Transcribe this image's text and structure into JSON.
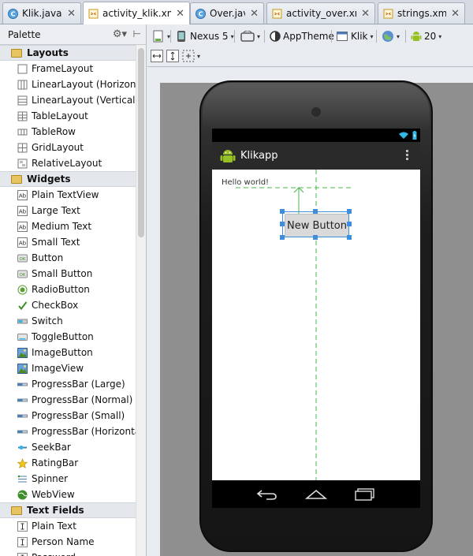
{
  "tabs": [
    {
      "label": "Klik.java",
      "type": "java",
      "active": false
    },
    {
      "label": "activity_klik.xml",
      "type": "xml",
      "active": true
    },
    {
      "label": "Over.java",
      "type": "java",
      "active": false
    },
    {
      "label": "activity_over.xml",
      "type": "xml",
      "active": false
    },
    {
      "label": "strings.xml",
      "type": "xml",
      "active": false
    }
  ],
  "palette": {
    "title": "Palette",
    "categories": [
      {
        "name": "Layouts",
        "items": [
          {
            "label": "FrameLayout",
            "icon": "frame-layout-icon"
          },
          {
            "label": "LinearLayout (Horizontal)",
            "icon": "linear-horizontal-icon"
          },
          {
            "label": "LinearLayout (Vertical)",
            "icon": "linear-vertical-icon"
          },
          {
            "label": "TableLayout",
            "icon": "table-layout-icon"
          },
          {
            "label": "TableRow",
            "icon": "table-row-icon"
          },
          {
            "label": "GridLayout",
            "icon": "grid-layout-icon"
          },
          {
            "label": "RelativeLayout",
            "icon": "relative-layout-icon"
          }
        ]
      },
      {
        "name": "Widgets",
        "items": [
          {
            "label": "Plain TextView",
            "icon": "textview-icon"
          },
          {
            "label": "Large Text",
            "icon": "large-text-icon"
          },
          {
            "label": "Medium Text",
            "icon": "medium-text-icon"
          },
          {
            "label": "Small Text",
            "icon": "small-text-icon"
          },
          {
            "label": "Button",
            "icon": "button-icon"
          },
          {
            "label": "Small Button",
            "icon": "small-button-icon"
          },
          {
            "label": "RadioButton",
            "icon": "radio-button-icon"
          },
          {
            "label": "CheckBox",
            "icon": "checkbox-icon"
          },
          {
            "label": "Switch",
            "icon": "switch-icon"
          },
          {
            "label": "ToggleButton",
            "icon": "toggle-button-icon"
          },
          {
            "label": "ImageButton",
            "icon": "image-button-icon"
          },
          {
            "label": "ImageView",
            "icon": "image-view-icon"
          },
          {
            "label": "ProgressBar (Large)",
            "icon": "progressbar-icon"
          },
          {
            "label": "ProgressBar (Normal)",
            "icon": "progressbar-icon"
          },
          {
            "label": "ProgressBar (Small)",
            "icon": "progressbar-icon"
          },
          {
            "label": "ProgressBar (Horizontal)",
            "icon": "progressbar-icon"
          },
          {
            "label": "SeekBar",
            "icon": "seekbar-icon"
          },
          {
            "label": "RatingBar",
            "icon": "rating-bar-icon"
          },
          {
            "label": "Spinner",
            "icon": "spinner-icon"
          },
          {
            "label": "WebView",
            "icon": "webview-icon"
          }
        ]
      },
      {
        "name": "Text Fields",
        "items": [
          {
            "label": "Plain Text",
            "icon": "text-field-icon"
          },
          {
            "label": "Person Name",
            "icon": "text-field-icon"
          },
          {
            "label": "Password",
            "icon": "text-field-icon"
          }
        ]
      }
    ]
  },
  "toolbar": {
    "device": "Nexus 5",
    "theme": "AppTheme",
    "activity": "Klik",
    "api_level": "20"
  },
  "preview": {
    "app_title": "Klikapp",
    "hello_text": "Hello world!",
    "button_label": "New Button"
  },
  "colors": {
    "selection": "#3d8fde",
    "guide": "#46b846",
    "android_green": "#97c024"
  }
}
